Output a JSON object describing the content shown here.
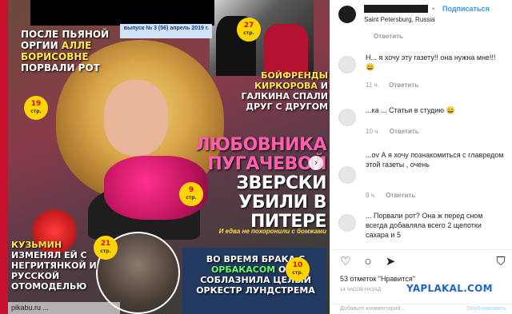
{
  "cover": {
    "issue_text": "выпуск № 3 (56)\nапрель 2019 г.",
    "headline1_a": "После пьяной оргии ",
    "headline1_b": "Алле Борисовне",
    "headline1_c": " порвали рот",
    "headline2_a": "Бойфренды ",
    "headline2_b": "Киркорова",
    "headline2_c": " и Галкина спали друг с другом",
    "headline3_a": "Любовника ",
    "headline3_b": "Пугачевой",
    "headline3_c": " зверски убили в Питере",
    "subline": "И едва не похоронили с бомжами",
    "headline4_a": "Кузьмин ",
    "headline4_b": "изменял ей с негритянкой и русской отомоделью",
    "headline5_a": "Во время брака с ",
    "headline5_b": "Орбакасом",
    "headline5_c": " она соблазнила целый оркестр Лундстрема",
    "badges": [
      {
        "num": "19",
        "unit": "стр."
      },
      {
        "num": "27",
        "unit": "стр."
      },
      {
        "num": "9",
        "unit": "стр."
      },
      {
        "num": "21",
        "unit": "стр."
      },
      {
        "num": "10",
        "unit": "стр."
      }
    ],
    "bottom_watermark": "pikabu.ru ..."
  },
  "post": {
    "location": "Saint Petersburg, Russia",
    "follow_label": "Подписаться",
    "dot": "•"
  },
  "comments": [
    {
      "meta_time": "",
      "reply": "Ответить",
      "text": ""
    },
    {
      "user": "Н...",
      "text": "Н... я хочу эту газету!! она нужна мне!!! 😄",
      "meta_time": "11 ч.",
      "reply": "Ответить"
    },
    {
      "user": "...ка ...",
      "text": "...ка ... Статьи в студию 😄",
      "meta_time": "10 ч.",
      "reply": "Ответить"
    },
    {
      "user": "...ov",
      "text": "...ov А я хочу познакомиться с главредом этой газеты , очень",
      "meta_time": "9 ч.",
      "reply": "Ответить"
    },
    {
      "user": "...",
      "text": "... Порвали рот? Она ж перед сном всегда добавляла всего 2 щепотки сахара и 5",
      "meta_time": "",
      "reply": ""
    }
  ],
  "actions": {
    "like": "♡",
    "comment": "○",
    "share": "➤",
    "save": "⛉"
  },
  "likes_text": "53 отметок \"Нравится\"",
  "time_text": "14 часов назад",
  "watermark": "YAPLAKAL.COM",
  "add_comment_placeholder": "Добавьте комментарий...",
  "publish_label": "Опубликовать"
}
